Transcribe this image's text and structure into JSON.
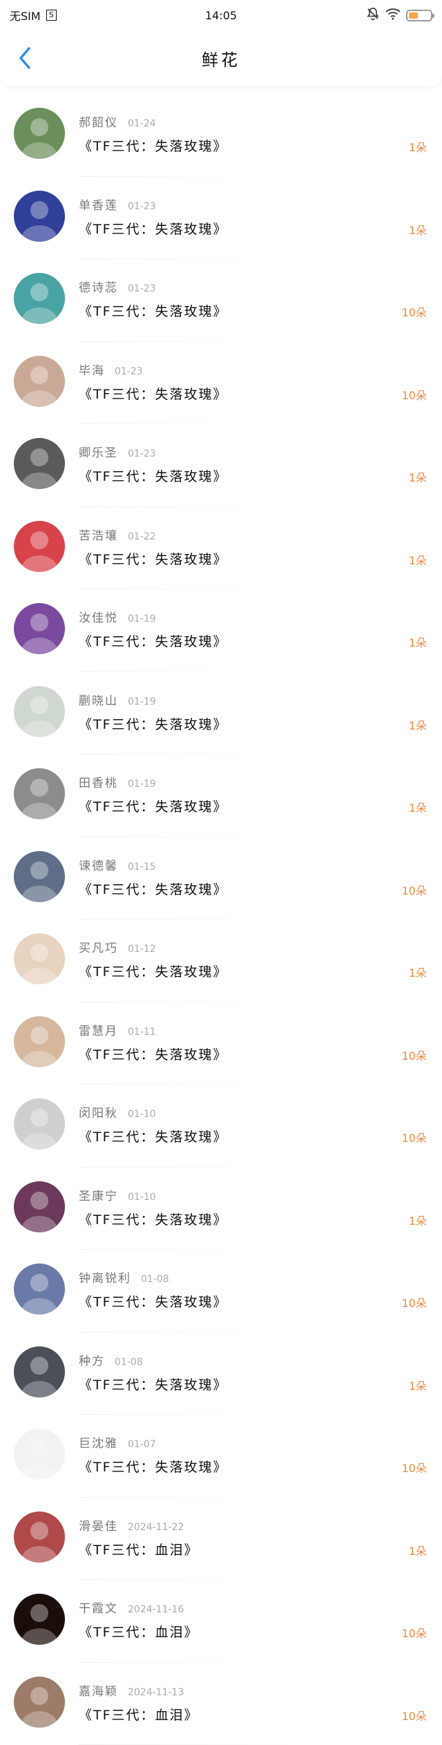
{
  "status_bar": {
    "carrier": "无SIM",
    "sim_badge": "S",
    "time": "14:05",
    "battery_level": 0.45
  },
  "header": {
    "title": "鲜花",
    "back_icon": "chevron-left-icon"
  },
  "colors": {
    "accent": "#2f8ff0",
    "count": "#f08a3e"
  },
  "rows": [
    {
      "name": "郝韶仪",
      "date": "01-24",
      "book": "《TF三代：失落玫瑰》",
      "count": "1朵",
      "avatar_color": "#6b8f5a"
    },
    {
      "name": "单香莲",
      "date": "01-23",
      "book": "《TF三代：失落玫瑰》",
      "count": "1朵",
      "avatar_color": "#2f3f9a"
    },
    {
      "name": "德诗蕊",
      "date": "01-23",
      "book": "《TF三代：失落玫瑰》",
      "count": "10朵",
      "avatar_color": "#4aa3a3"
    },
    {
      "name": "毕海",
      "date": "01-23",
      "book": "《TF三代：失落玫瑰》",
      "count": "10朵",
      "avatar_color": "#c9a996"
    },
    {
      "name": "卿乐圣",
      "date": "01-23",
      "book": "《TF三代：失落玫瑰》",
      "count": "1朵",
      "avatar_color": "#5a5a5a"
    },
    {
      "name": "苦浩壤",
      "date": "01-22",
      "book": "《TF三代：失落玫瑰》",
      "count": "1朵",
      "avatar_color": "#d8434a"
    },
    {
      "name": "汝佳悦",
      "date": "01-19",
      "book": "《TF三代：失落玫瑰》",
      "count": "1朵",
      "avatar_color": "#7b4a9e"
    },
    {
      "name": "蒯晓山",
      "date": "01-19",
      "book": "《TF三代：失落玫瑰》",
      "count": "1朵",
      "avatar_color": "#cfd8cf"
    },
    {
      "name": "田香桃",
      "date": "01-19",
      "book": "《TF三代：失落玫瑰》",
      "count": "1朵",
      "avatar_color": "#8c8c8c"
    },
    {
      "name": "谏德馨",
      "date": "01-15",
      "book": "《TF三代：失落玫瑰》",
      "count": "10朵",
      "avatar_color": "#5d6e86"
    },
    {
      "name": "买凡巧",
      "date": "01-12",
      "book": "《TF三代：失落玫瑰》",
      "count": "1朵",
      "avatar_color": "#e8d2c0"
    },
    {
      "name": "雷慧月",
      "date": "01-11",
      "book": "《TF三代：失落玫瑰》",
      "count": "10朵",
      "avatar_color": "#d6b79e"
    },
    {
      "name": "闵阳秋",
      "date": "01-10",
      "book": "《TF三代：失落玫瑰》",
      "count": "10朵",
      "avatar_color": "#cfcfcf"
    },
    {
      "name": "圣康宁",
      "date": "01-10",
      "book": "《TF三代：失落玫瑰》",
      "count": "1朵",
      "avatar_color": "#6b3a5a"
    },
    {
      "name": "钟离锐利",
      "date": "01-08",
      "book": "《TF三代：失落玫瑰》",
      "count": "10朵",
      "avatar_color": "#6a7aa8"
    },
    {
      "name": "种方",
      "date": "01-08",
      "book": "《TF三代：失落玫瑰》",
      "count": "1朵",
      "avatar_color": "#4a4f58"
    },
    {
      "name": "巨沈雅",
      "date": "01-07",
      "book": "《TF三代：失落玫瑰》",
      "count": "10朵",
      "avatar_color": "#f2f2f2"
    },
    {
      "name": "滑晏佳",
      "date": "2024-11-22",
      "book": "《TF三代：血泪》",
      "count": "1朵",
      "avatar_color": "#b04a4a"
    },
    {
      "name": "干霞文",
      "date": "2024-11-16",
      "book": "《TF三代：血泪》",
      "count": "10朵",
      "avatar_color": "#1a0d0a"
    },
    {
      "name": "嘉海颖",
      "date": "2024-11-13",
      "book": "《TF三代：血泪》",
      "count": "10朵",
      "avatar_color": "#9c7c68"
    }
  ]
}
